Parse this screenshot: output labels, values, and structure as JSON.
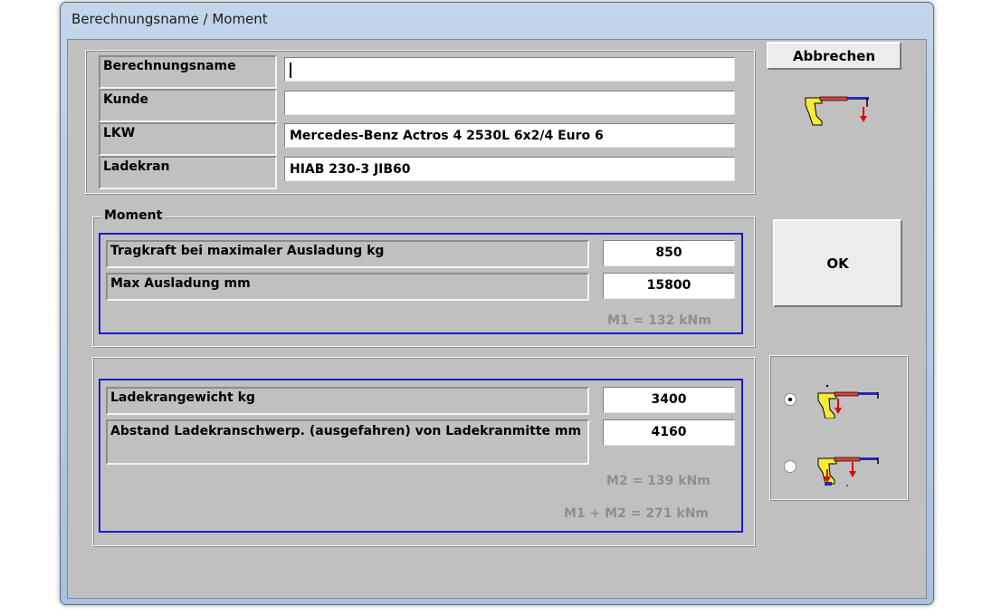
{
  "window": {
    "title": "Berechnungsname   /   Moment"
  },
  "info": {
    "rows": [
      {
        "label": "Berechnungsname",
        "value": ""
      },
      {
        "label": "Kunde",
        "value": ""
      },
      {
        "label": "LKW",
        "value": "Mercedes-Benz Actros 4 2530L 6x2/4 Euro 6"
      },
      {
        "label": "Ladekran",
        "value": "HIAB  230-3 JIB60"
      }
    ]
  },
  "moment": {
    "legend": "Moment",
    "load_label": "Tragkraft bei maximaler Ausladung  kg",
    "load_value": "850",
    "reach_label": "Max Ausladung   mm",
    "reach_value": "15800",
    "m1_result": "M1 = 132 kNm"
  },
  "crane_weight": {
    "weight_label": "Ladekrangewicht  kg",
    "weight_value": "3400",
    "distance_label": "Abstand Ladekranschwerp. (ausgefahren) von Ladekranmitte mm",
    "distance_value": "4160",
    "m2_result": "M2 = 139 kNm",
    "total_result": "M1 + M2 = 271 kNm"
  },
  "buttons": {
    "cancel": "Abbrechen",
    "ok": "OK"
  },
  "options": {
    "selected_index": 0
  },
  "icons": [
    "crane-icon",
    "crane-extended-icon",
    "crane-jib-icon"
  ]
}
